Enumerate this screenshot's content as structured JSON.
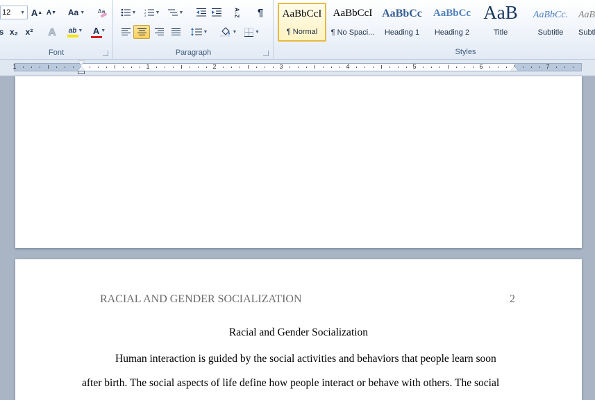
{
  "font_group": {
    "label": "Font",
    "font_size": "12",
    "grow_font": "A",
    "shrink_font": "A",
    "change_case": "Aa",
    "subscript": "x₂",
    "superscript": "x²",
    "text_effects": "A",
    "highlight": "ab",
    "font_color": "A",
    "highlight_color": "#f4e400",
    "font_color_value": "#d41f1f"
  },
  "paragraph_group": {
    "label": "Paragraph",
    "sort": "A↓Z",
    "pilcrow": "¶"
  },
  "styles_group": {
    "label": "Styles",
    "items": [
      {
        "sample": "AaBbCcI",
        "name": "¶ Normal"
      },
      {
        "sample": "AaBbCcI",
        "name": "¶ No Spaci..."
      },
      {
        "sample": "AaBbCc",
        "name": "Heading 1"
      },
      {
        "sample": "AaBbCc",
        "name": "Heading 2"
      },
      {
        "sample": "AaB",
        "name": "Title"
      },
      {
        "sample": "AaBbCc.",
        "name": "Subtitle"
      },
      {
        "sample": "AaBbCcL",
        "name": "Subtle..."
      }
    ]
  },
  "ruler": {
    "numbers": [
      "1",
      "1",
      "2",
      "3",
      "4",
      "5",
      "6",
      "7"
    ]
  },
  "document": {
    "running_head": "RACIAL AND GENDER SOCIALIZATION",
    "page_number": "2",
    "title": "Racial and Gender Socialization",
    "paragraph_line_1": "Human interaction is guided by the social activities and behaviors that people learn soon",
    "paragraph_line_2": "after birth. The social aspects of life define how people interact or behave with others. The social"
  }
}
